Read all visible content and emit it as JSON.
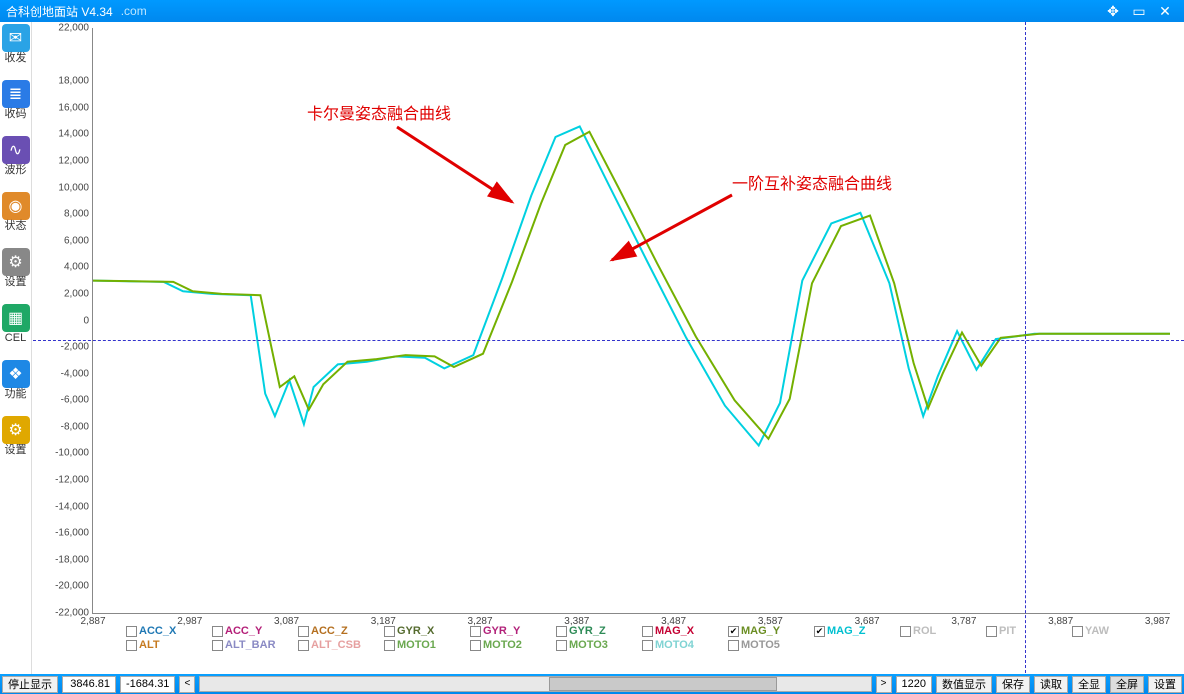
{
  "titlebar": {
    "title": "合科创地面站 V4.34",
    "url": ".com"
  },
  "sidebar": [
    {
      "label": "收发",
      "color": "#2aa3e6",
      "glyph": "✉"
    },
    {
      "label": "收码",
      "color": "#2a7be6",
      "glyph": "≣"
    },
    {
      "label": "波形",
      "color": "#6a4fb3",
      "glyph": "∿"
    },
    {
      "label": "状态",
      "color": "#e08a2a",
      "glyph": "◉"
    },
    {
      "label": "设置",
      "color": "#888888",
      "glyph": "⚙"
    },
    {
      "label": "CEL",
      "color": "#1fa866",
      "glyph": "▦"
    },
    {
      "label": "功能",
      "color": "#1e88e5",
      "glyph": "❖"
    },
    {
      "label": "设置",
      "color": "#e0a800",
      "glyph": "⚙"
    }
  ],
  "annotations": {
    "kalman": "卡尔曼姿态融合曲线",
    "complementary": "一阶互补姿态融合曲线"
  },
  "legend": [
    {
      "name": "ACC_X",
      "color": "#1f78b4",
      "checked": false
    },
    {
      "name": "ACC_Y",
      "color": "#b41f78",
      "checked": false
    },
    {
      "name": "ACC_Z",
      "color": "#b46f1f",
      "checked": false
    },
    {
      "name": "GYR_X",
      "color": "#556b2f",
      "checked": false
    },
    {
      "name": "GYR_Y",
      "color": "#b2227a",
      "checked": false
    },
    {
      "name": "GYR_Z",
      "color": "#2e8b57",
      "checked": false
    },
    {
      "name": "MAG_X",
      "color": "#c40233",
      "checked": false
    },
    {
      "name": "MAG_Y",
      "color": "#6b8e23",
      "checked": true
    },
    {
      "name": "MAG_Z",
      "color": "#00c0d0",
      "checked": true
    },
    {
      "name": "ROL",
      "color": "#bdbdbd",
      "checked": false
    },
    {
      "name": "PIT",
      "color": "#bdbdbd",
      "checked": false
    },
    {
      "name": "YAW",
      "color": "#bdbdbd",
      "checked": false
    },
    {
      "name": "ALT",
      "color": "#c67a1f",
      "checked": false
    },
    {
      "name": "ALT_BAR",
      "color": "#8a8ac4",
      "checked": false
    },
    {
      "name": "ALT_CSB",
      "color": "#e6a0a0",
      "checked": false
    },
    {
      "name": "MOTO1",
      "color": "#6aa84f",
      "checked": false
    },
    {
      "name": "MOTO2",
      "color": "#6aa84f",
      "checked": false
    },
    {
      "name": "MOTO3",
      "color": "#6aa84f",
      "checked": false
    },
    {
      "name": "MOTO4",
      "color": "#7fd3d3",
      "checked": false
    },
    {
      "name": "MOTO5",
      "color": "#999999",
      "checked": false
    }
  ],
  "statusbar": {
    "stop": "停止显示",
    "v1": "3846.81",
    "v2": "-1684.31",
    "step": "1220",
    "numdisp": "数值显示",
    "save": "保存",
    "read": "读取",
    "allshow": "全显",
    "fullscreen": "全屏",
    "settings": "设置"
  },
  "chart_data": {
    "type": "line",
    "title": "",
    "xlabel": "",
    "ylabel": "",
    "xlim": [
      2887,
      4000
    ],
    "ylim": [
      -22000,
      22000
    ],
    "xticks": [
      2887,
      2987,
      3087,
      3187,
      3287,
      3387,
      3487,
      3587,
      3687,
      3787,
      3887,
      3987
    ],
    "yticks": [
      -22000,
      -20000,
      -18000,
      -16000,
      -14000,
      -12000,
      -10000,
      -8000,
      -6000,
      -4000,
      -2000,
      0,
      2000,
      4000,
      6000,
      8000,
      10000,
      12000,
      14000,
      16000,
      18000,
      22000
    ],
    "cursor_x": 3850,
    "zero_line_y": -1500,
    "series": [
      {
        "name": "MAG_Z",
        "color": "#00d0e0",
        "x": [
          2887,
          2960,
          2980,
          3010,
          3050,
          3065,
          3075,
          3090,
          3105,
          3115,
          3140,
          3170,
          3200,
          3230,
          3250,
          3280,
          3310,
          3340,
          3365,
          3390,
          3420,
          3460,
          3500,
          3540,
          3575,
          3597,
          3620,
          3650,
          3680,
          3710,
          3730,
          3745,
          3760,
          3780,
          3800,
          3820,
          3840,
          3860,
          4000
        ],
        "y": [
          3000,
          2900,
          2200,
          2000,
          1900,
          -5500,
          -7200,
          -4500,
          -7800,
          -5000,
          -3300,
          -3100,
          -2700,
          -2800,
          -3600,
          -2600,
          3200,
          9400,
          13800,
          14600,
          10200,
          4400,
          -1300,
          -6400,
          -9400,
          -6200,
          3000,
          7300,
          8100,
          2800,
          -3600,
          -7200,
          -4200,
          -800,
          -3700,
          -1400,
          -1200,
          -1000,
          -1000
        ]
      },
      {
        "name": "MAG_Y",
        "color": "#74b000",
        "x": [
          2887,
          2970,
          2990,
          3020,
          3060,
          3080,
          3095,
          3110,
          3125,
          3150,
          3180,
          3210,
          3240,
          3260,
          3290,
          3320,
          3350,
          3375,
          3400,
          3430,
          3470,
          3510,
          3550,
          3585,
          3607,
          3630,
          3660,
          3690,
          3715,
          3735,
          3750,
          3765,
          3785,
          3805,
          3825,
          3845,
          3865,
          4000
        ],
        "y": [
          3000,
          2900,
          2200,
          2000,
          1900,
          -5000,
          -4200,
          -6700,
          -4800,
          -3100,
          -2900,
          -2600,
          -2700,
          -3500,
          -2500,
          2900,
          8800,
          13200,
          14200,
          10000,
          4300,
          -1200,
          -6000,
          -8900,
          -5900,
          2800,
          7100,
          7900,
          2800,
          -3200,
          -6600,
          -4000,
          -900,
          -3400,
          -1300,
          -1150,
          -1000,
          -1000
        ]
      }
    ]
  }
}
